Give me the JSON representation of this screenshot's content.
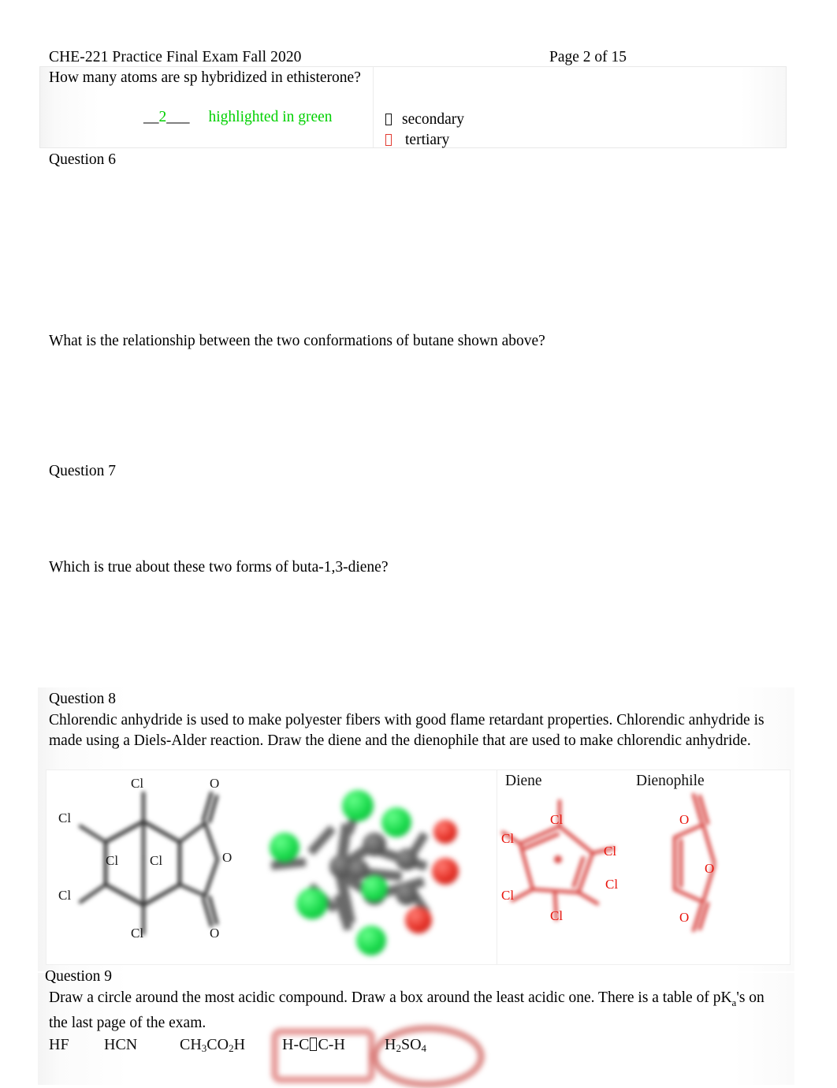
{
  "header": {
    "left": "CHE-221 Practice Final Exam Fall 2020",
    "right": "Page 2 of 15"
  },
  "question5_tail": {
    "prompt": "How many atoms are sp hybridized in ethisterone?",
    "answer_blank_lead": "__",
    "answer_value": "2",
    "answer_blank_trail": "___",
    "answer_note": "highlighted in green",
    "answer_color": "#00d000",
    "choices": [
      {
        "marker": "missing-glyph-box",
        "marker_color": "#111111",
        "label": "secondary"
      },
      {
        "marker": "missing-glyph-box",
        "marker_color": "#e23b32",
        "label": "tertiary"
      }
    ]
  },
  "question6": {
    "heading": "Question 6",
    "text": "What is the relationship between the two conformations of butane shown above?"
  },
  "question7": {
    "heading": "Question 7",
    "text": "Which is true about these two forms of buta-1,3-diene?"
  },
  "question8": {
    "heading": "Question 8",
    "text": "Chlorendic anhydride is used to make polyester fibers with good flame retardant properties.    Chlorendic anhydride is made using a Diels-Alder reaction.  Draw the diene and the dienophile that are used to make chlorendic anhydride.",
    "structure_labels": {
      "chlorine": "Cl",
      "oxygen": "O"
    },
    "given_structure_cl_count": 6,
    "given_structure_o_count": 3,
    "model_legend": {
      "chlorine_color": "#18d84a",
      "carbon_color": "#5e5e5e",
      "oxygen_color": "#e53127"
    },
    "answer_headings": {
      "diene": "Diene",
      "dienophile": "Dienophile"
    },
    "answer_ink_color": "#d94a47",
    "diene_labels": [
      "Cl",
      "Cl",
      "Cl",
      "Cl",
      "Cl",
      "Cl"
    ],
    "dienophile_labels": [
      "O",
      "O",
      "O"
    ]
  },
  "question9": {
    "heading": "Question 9",
    "text": "Draw a circle around the most acidic compound.   Draw a box around the least acidic one.   There is a table of pKa's on the last page of the exam.",
    "text_pka_prefix": "pK",
    "text_pka_sub": "a",
    "text_pka_suffix": "'s on the last page of the exam.",
    "text_line1": "Draw a circle around the most acidic compound.   Draw a box around the least acidic one.   There is a table of",
    "compounds": [
      {
        "formula_html": "HF",
        "annotation": "none"
      },
      {
        "formula_html": "HCN",
        "annotation": "none"
      },
      {
        "formula_html": "CH3CO2H",
        "annotation": "none"
      },
      {
        "formula_html": "H-C?C-H",
        "annotation": "box"
      },
      {
        "formula_html": "H2SO4",
        "annotation": "circle"
      }
    ],
    "annotation_colors": {
      "box": "#d6605c",
      "circle": "#cd5854"
    }
  }
}
